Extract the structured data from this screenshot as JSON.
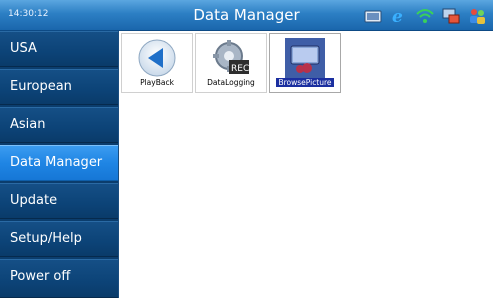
{
  "statusbar": {
    "time": "14:30:12",
    "title": "Data Manager",
    "icons": [
      "tablet-icon",
      "browser-icon",
      "wifi-icon",
      "network-icon",
      "users-icon"
    ]
  },
  "sidebar": {
    "items": [
      {
        "label": "USA"
      },
      {
        "label": "European"
      },
      {
        "label": "Asian"
      },
      {
        "label": "Data Manager",
        "active": true
      },
      {
        "label": "Update"
      },
      {
        "label": "Setup/Help"
      },
      {
        "label": "Power off"
      }
    ]
  },
  "apps": [
    {
      "label": "PlayBack",
      "icon": "playback-icon"
    },
    {
      "label": "DataLogging",
      "icon": "datalogging-icon"
    },
    {
      "label": "BrowsePicture",
      "icon": "browse-picture-icon",
      "selected": true
    }
  ],
  "colors": {
    "titlebar": "#2c7fc4",
    "nav_bg": "#0c4377",
    "nav_active": "#1f85e4",
    "selection": "#1b2fa0"
  }
}
